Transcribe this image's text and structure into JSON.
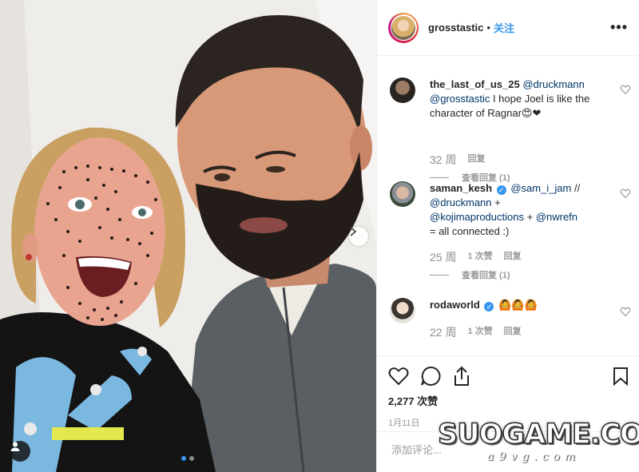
{
  "post": {
    "owner": "grosstastic",
    "separator": "•",
    "follow_label": "关注",
    "more_label": "•••"
  },
  "comments": [
    {
      "username": "the_last_of_us_25",
      "verified": false,
      "text_mention1": "@druckmann",
      "text_mention2": "@grosstastic",
      "text_plain": " I hope Joel is like the character of Ragnar",
      "emoji": "😍❤",
      "time": "32 周",
      "likes": "",
      "reply_label": "回复",
      "view_replies": "查看回复 (1)"
    },
    {
      "username": "saman_kesh",
      "verified": true,
      "text_mention1": "@sam_i_jam",
      "text_plain1": " //",
      "text_mention2": "@druckmann",
      "text_plain2": " +",
      "text_mention3": "@kojimaproductions",
      "text_plain3": " + ",
      "text_mention4": "@nwrefn",
      "text_plain4": "= all connected :)",
      "time": "25 周",
      "likes": "1 次赞",
      "reply_label": "回复",
      "view_replies": "查看回复 (1)"
    },
    {
      "username": "rodaworld",
      "verified": true,
      "emoji": "🙆🙆🙆",
      "time": "22 周",
      "likes": "1 次赞",
      "reply_label": "回复"
    }
  ],
  "actions": {
    "likes_count": "2,277 次赞",
    "date": "1月11日"
  },
  "add_comment": {
    "placeholder": "添加评论..."
  },
  "carousel": {
    "total": 2,
    "active_index": 0
  },
  "watermark": {
    "main": "SUOGAME.COM",
    "sub": "a9vg.com"
  },
  "colors": {
    "accent": "#3897f0",
    "text": "#262626",
    "muted": "#999999",
    "heart_red": "#ed4956"
  }
}
